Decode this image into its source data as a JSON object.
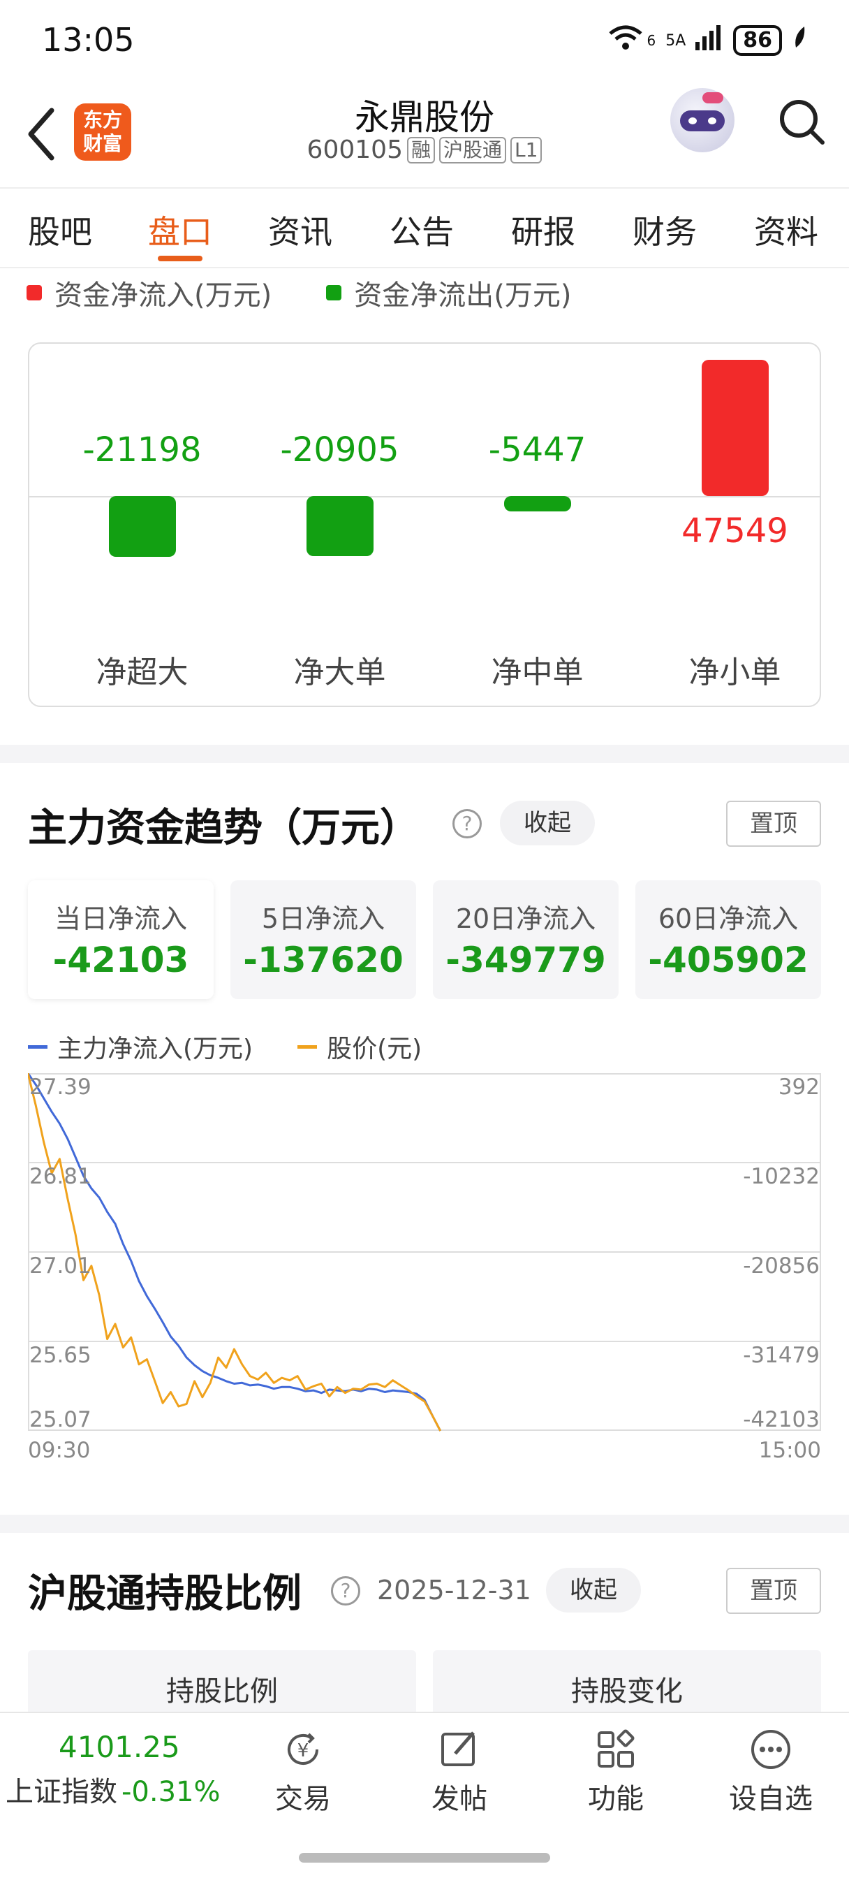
{
  "status_bar": {
    "time": "13:05",
    "wifi_label": "6",
    "signal_label": "5A",
    "battery": "86"
  },
  "header": {
    "logo_line1": "东方",
    "logo_line2": "财富",
    "stock_name": "永鼎股份",
    "stock_code": "600105",
    "tags": [
      "融",
      "沪股通",
      "L1"
    ]
  },
  "tabs": [
    "股吧",
    "盘口",
    "资讯",
    "公告",
    "研报",
    "财务",
    "资料"
  ],
  "active_tab": "盘口",
  "money_flow": {
    "legend_in": "资金净流入(万元)",
    "legend_out": "资金净流出(万元)",
    "color_in": "#f22a2a",
    "color_out": "#12a012",
    "bars": [
      {
        "label": "净超大",
        "value": -21198,
        "display": "-21198"
      },
      {
        "label": "净大单",
        "value": -20905,
        "display": "-20905"
      },
      {
        "label": "净中单",
        "value": -5447,
        "display": "-5447"
      },
      {
        "label": "净小单",
        "value": 47549,
        "display": "47549"
      }
    ]
  },
  "trend": {
    "title": "主力资金趋势（万元）",
    "collapse_label": "收起",
    "pin_label": "置顶",
    "stats": [
      {
        "label": "当日净流入",
        "value": "-42103"
      },
      {
        "label": "5日净流入",
        "value": "-137620"
      },
      {
        "label": "20日净流入",
        "value": "-349779"
      },
      {
        "label": "60日净流入",
        "value": "-405902"
      }
    ],
    "legend_flow": "主力净流入(万元)",
    "legend_price": "股价(元)"
  },
  "chart_data": {
    "type": "line",
    "x_start_label": "09:30",
    "x_end_label": "15:00",
    "left_axis_labels": [
      "27.39",
      "26.81",
      "27.01",
      "25.65",
      "25.07"
    ],
    "right_axis_labels": [
      "392",
      "-10232",
      "-20856",
      "-31479",
      "-42103"
    ],
    "right_ylim": [
      -42103,
      392
    ],
    "x_range": [
      0,
      100
    ],
    "series": [
      {
        "name": "主力净流入(万元)",
        "color": "#4169d8",
        "x": [
          0,
          1,
          2,
          3,
          4,
          5,
          6,
          7,
          8,
          9,
          10,
          11,
          12,
          13,
          14,
          15,
          16,
          17,
          18,
          19,
          20,
          21,
          22,
          23,
          24,
          25,
          26,
          27,
          28,
          29,
          30,
          31,
          32,
          33,
          34,
          35,
          36,
          37,
          38,
          39,
          40,
          41,
          42,
          43,
          44,
          45,
          46,
          47,
          48,
          49,
          50,
          51,
          52
        ],
        "values": [
          392,
          -1000,
          -2600,
          -4200,
          -5600,
          -7400,
          -9600,
          -11800,
          -13300,
          -14400,
          -16100,
          -17500,
          -19900,
          -21900,
          -24300,
          -26100,
          -27600,
          -29200,
          -30900,
          -32000,
          -33400,
          -34300,
          -35000,
          -35500,
          -35800,
          -36200,
          -36500,
          -36400,
          -36700,
          -36600,
          -36800,
          -37100,
          -36900,
          -36900,
          -37100,
          -37400,
          -37300,
          -37600,
          -37200,
          -37300,
          -37400,
          -37200,
          -37400,
          -37100,
          -37200,
          -37500,
          -37300,
          -37400,
          -37500,
          -37700,
          -38400,
          -40300,
          -42103
        ]
      },
      {
        "name": "股价(元)",
        "color": "#f0a21c",
        "x": [
          0,
          1,
          2,
          3,
          4,
          5,
          6,
          7,
          8,
          9,
          10,
          11,
          12,
          13,
          14,
          15,
          16,
          17,
          18,
          19,
          20,
          21,
          22,
          23,
          24,
          25,
          26,
          27,
          28,
          29,
          30,
          31,
          32,
          33,
          34,
          35,
          36,
          37,
          38,
          39,
          40,
          41,
          42,
          43,
          44,
          45,
          46,
          47,
          48,
          49,
          50,
          51,
          52
        ],
        "values": [
          392,
          -3500,
          -7800,
          -11500,
          -9800,
          -14500,
          -18800,
          -24200,
          -22500,
          -26000,
          -31200,
          -29400,
          -32200,
          -31000,
          -34200,
          -33600,
          -36200,
          -38800,
          -37500,
          -39200,
          -38900,
          -36200,
          -38100,
          -36400,
          -33400,
          -34600,
          -32400,
          -34200,
          -35600,
          -36000,
          -35200,
          -36400,
          -35800,
          -36100,
          -35600,
          -37200,
          -36800,
          -36500,
          -38000,
          -36900,
          -37600,
          -37100,
          -37200,
          -36600,
          -36500,
          -36900,
          -36100,
          -36700,
          -37300,
          -38000,
          -38600,
          -40300,
          -42103
        ]
      }
    ]
  },
  "hk_connect": {
    "title": "沪股通持股比例",
    "date": "2025-12-31",
    "collapse_label": "收起",
    "pin_label": "置顶",
    "col1": "持股比例",
    "col2": "持股变化"
  },
  "bottom_bar": {
    "index_value": "4101.25",
    "index_name": "上证指数",
    "index_pct": "-0.31%",
    "nav": [
      "交易",
      "发帖",
      "功能",
      "设自选"
    ]
  }
}
